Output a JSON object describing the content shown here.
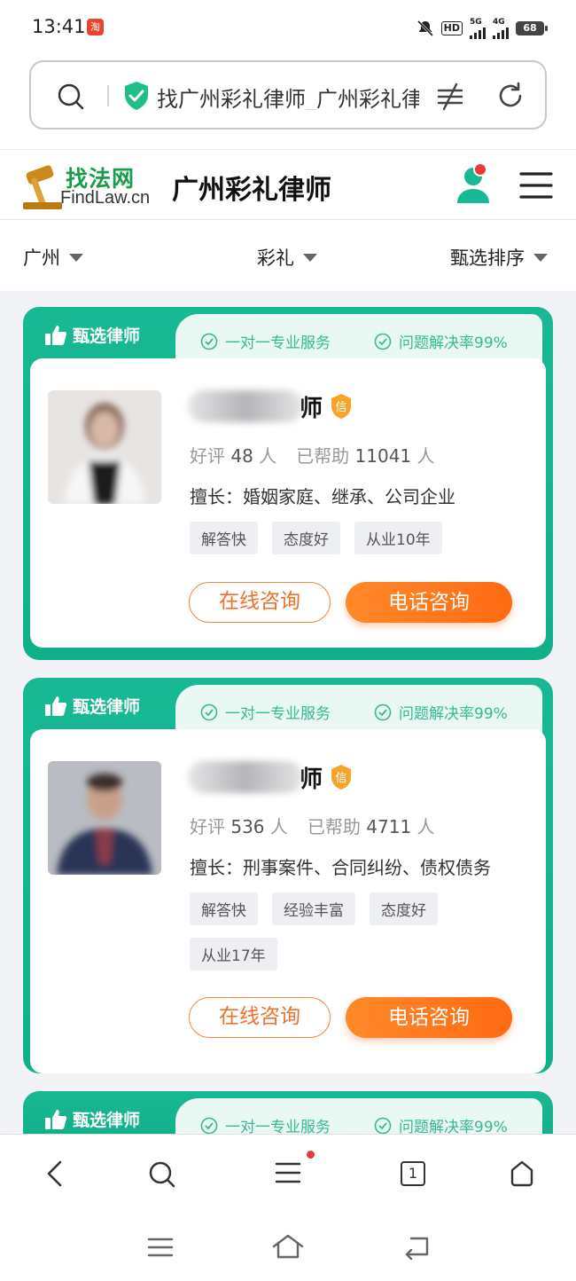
{
  "status_bar": {
    "time": "13:41",
    "app_badge": "淘",
    "network_hd": "HD",
    "network_5g": "5G",
    "network_4g": "4G",
    "battery": "68"
  },
  "browser": {
    "url_text": "找广州彩礼律师_广州彩礼律师"
  },
  "site": {
    "logo_cn": "找法网",
    "logo_en": "FindLaw.cn",
    "page_title": "广州彩礼律师"
  },
  "filters": [
    {
      "label": "广州"
    },
    {
      "label": "彩礼"
    },
    {
      "label": "甄选排序"
    }
  ],
  "card_header": {
    "badge": "甄选律师",
    "feature_1": "一对一专业服务",
    "feature_2": "问题解决率99%"
  },
  "lawyers": [
    {
      "name_suffix": "师",
      "verified_badge": "信",
      "rating_label": "好评",
      "rating_count": "48",
      "rating_unit": "人",
      "helped_label": "已帮助",
      "helped_count": "11041",
      "helped_unit": "人",
      "specialty": "擅长：婚姻家庭、继承、公司企业",
      "tags": [
        "解答快",
        "态度好",
        "从业10年"
      ],
      "btn_online": "在线咨询",
      "btn_phone": "电话咨询"
    },
    {
      "name_suffix": "师",
      "verified_badge": "信",
      "rating_label": "好评",
      "rating_count": "536",
      "rating_unit": "人",
      "helped_label": "已帮助",
      "helped_count": "4711",
      "helped_unit": "人",
      "specialty": "擅长：刑事案件、合同纠纷、债权债务",
      "tags": [
        "解答快",
        "经验丰富",
        "态度好",
        "从业17年"
      ],
      "btn_online": "在线咨询",
      "btn_phone": "电话咨询"
    }
  ],
  "bottom_nav": {
    "tab_count": "1"
  },
  "colors": {
    "brand_green": "#19b894",
    "orange": "#ff7a1e",
    "logo_green": "#1a9d4b"
  }
}
